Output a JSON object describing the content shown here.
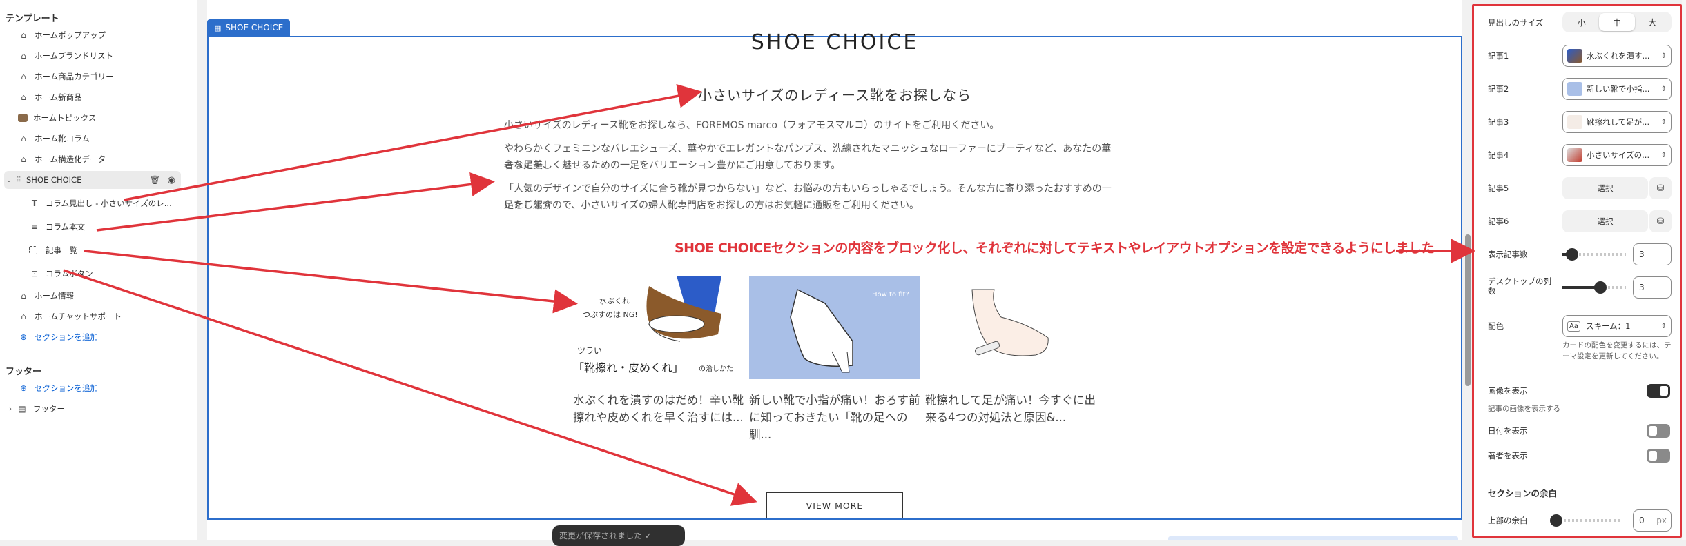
{
  "sidebar": {
    "template_heading": "テンプレート",
    "items": [
      {
        "label": "ホームポップアップ",
        "icon": "home-icon"
      },
      {
        "label": "ホームブランドリスト",
        "icon": "home-icon"
      },
      {
        "label": "ホーム商品カテゴリー",
        "icon": "home-icon"
      },
      {
        "label": "ホーム新商品",
        "icon": "home-icon"
      },
      {
        "label": "ホームトピックス",
        "icon": "image-thumb-icon"
      },
      {
        "label": "ホーム靴コラム",
        "icon": "home-icon"
      },
      {
        "label": "ホーム構造化データ",
        "icon": "home-icon"
      }
    ],
    "selected": {
      "label": "SHOE CHOICE"
    },
    "blocks": [
      {
        "label": "コラム見出し - 小さいサイズのレ..."
      },
      {
        "label": "コラム本文"
      },
      {
        "label": "記事一覧"
      },
      {
        "label": "コラムボタン"
      }
    ],
    "items2": [
      {
        "label": "ホーム情報"
      },
      {
        "label": "ホームチャットサポート"
      }
    ],
    "add_section": "セクションを追加",
    "footer_heading": "フッター",
    "footer_add_section": "セクションを追加",
    "footer_item": "フッター"
  },
  "preview": {
    "section_tag": "SHOE CHOICE",
    "title": "SHOE CHOICE",
    "heading": "小さいサイズのレディース靴をお探しなら",
    "paragraphs": [
      "小さいサイズのレディース靴をお探しなら、FOREMOS marco（フォアモスマルコ）のサイトをご利用ください。",
      "やわらかくフェミニンなバレエシューズ、華やかでエレガントなパンプス、洗練されたマニッシュなローファーにブーティなど、あなたの華奢な足を、",
      "さらに美しく魅せるための一足をバリエーション豊かにご用意しております。",
      "「人気のデザインで自分のサイズに合う靴が見つからない」など、お悩みの方もいらっしゃるでしょう。そんな方に寄り添ったおすすめの一足をご紹介",
      "いたしますので、小さいサイズの婦人靴専門店をお探しの方はお気軽に通販をご利用ください。"
    ],
    "cards": [
      {
        "img_text1": "水ぶくれ",
        "img_text2": "つぶすのは NG!",
        "img_text3": "ツラい",
        "img_text4": "「靴擦れ・皮めくれ」",
        "img_text5": "の治しかた",
        "caption": "水ぶくれを潰すのはだめ！辛い靴擦れや皮めくれを早く治すには..."
      },
      {
        "img_text1": "How to fit?",
        "caption": "新しい靴で小指が痛い！おろす前に知っておきたい「靴の足への馴..."
      },
      {
        "caption": "靴擦れして足が痛い！今すぐに出来る4つの対処法と原因&..."
      }
    ],
    "view_more": "VIEW MORE",
    "toast": "変更が保存されました ✓"
  },
  "annotation": {
    "note": "SHOE CHOICEセクションの内容をブロック化し、それぞれに対してテキストやレイアウトオプションを設定できるようにしました",
    "color": "#e0343b"
  },
  "settings": {
    "heading_size": {
      "label": "見出しのサイズ",
      "options": [
        "小",
        "中",
        "大"
      ],
      "selected": "中"
    },
    "articles": [
      {
        "label": "記事1",
        "value": "水ぶくれを潰す..."
      },
      {
        "label": "記事2",
        "value": "新しい靴で小指..."
      },
      {
        "label": "記事3",
        "value": "靴擦れして足が..."
      },
      {
        "label": "記事4",
        "value": "小さいサイズの..."
      },
      {
        "label": "記事5",
        "value": "選択"
      },
      {
        "label": "記事6",
        "value": "選択"
      }
    ],
    "display_count": {
      "label": "表示記事数",
      "value": "3",
      "fraction": 0.15
    },
    "desktop_columns": {
      "label": "デスクトップの列数",
      "value": "3",
      "fraction": 0.6
    },
    "color_scheme": {
      "label": "配色",
      "value": "スキーム：1",
      "help": "カードの配色を変更するには、テーマ設定を更新してください。"
    },
    "show_image": {
      "label": "画像を表示",
      "help": "記事の画像を表示する",
      "on": true
    },
    "show_date": {
      "label": "日付を表示",
      "on": false
    },
    "show_author": {
      "label": "著者を表示",
      "on": false
    },
    "section_margin": {
      "heading": "セクションの余白",
      "label": "上部の余白",
      "value": "0",
      "unit": "px"
    }
  }
}
